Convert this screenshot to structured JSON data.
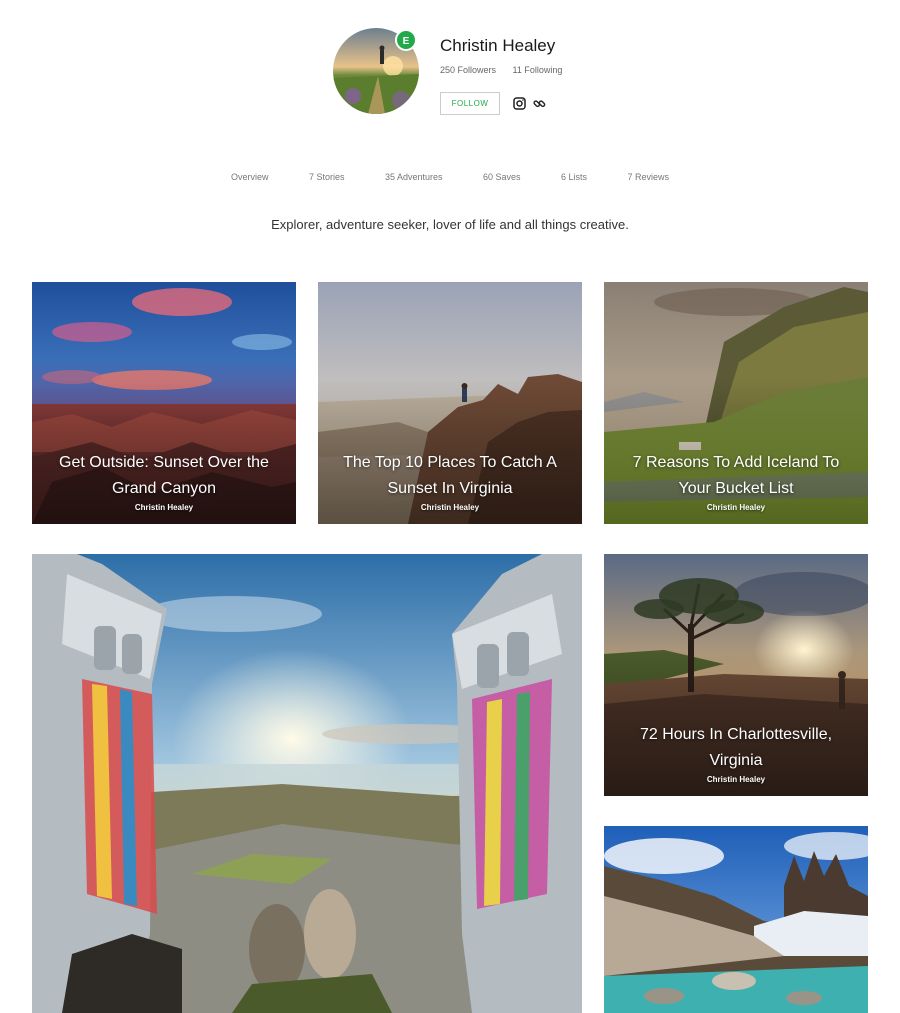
{
  "profile": {
    "name": "Christin Healey",
    "badge": "E",
    "followers": "250 Followers",
    "following": "11 Following",
    "follow_label": "FOLLOW",
    "social_icons": [
      "instagram-icon",
      "link-icon"
    ]
  },
  "tabs": [
    "Overview",
    "7 Stories",
    "35 Adventures",
    "60 Saves",
    "6 Lists",
    "7 Reviews"
  ],
  "bio": "Explorer, adventure seeker, lover of life and all things creative.",
  "cards": [
    {
      "title_line1": "Get Outside: Sunset Over the",
      "title_line2": "Grand Canyon",
      "author": "Christin Healey"
    },
    {
      "title_line1": "The Top 10 Places To Catch A",
      "title_line2": "Sunset In Virginia",
      "author": "Christin Healey"
    },
    {
      "title_line1": "7 Reasons To Add Iceland To",
      "title_line2": "Your Bucket List",
      "author": "Christin Healey"
    },
    {
      "title_line1": "72 Hours In Charlottesville,",
      "title_line2": "Virginia",
      "author": "Christin Healey"
    }
  ],
  "colors": {
    "accent_green": "#22a94a"
  }
}
